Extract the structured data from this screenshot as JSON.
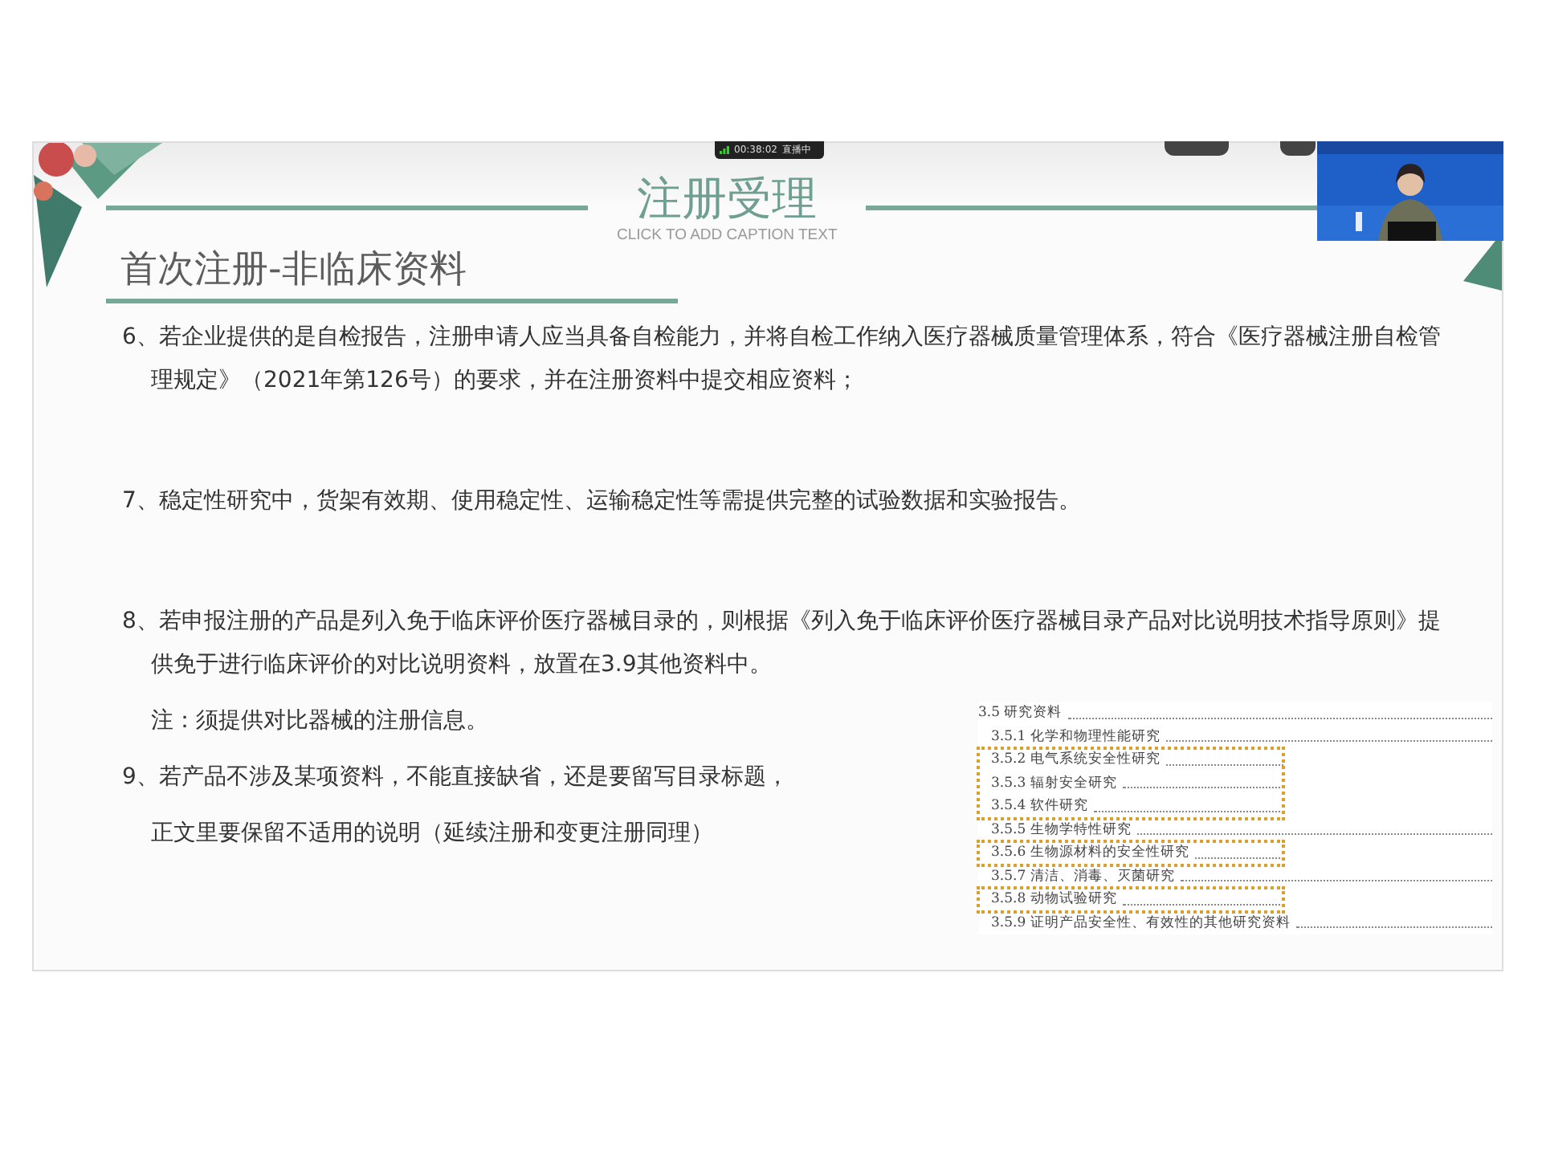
{
  "live_indicator": {
    "time": "00:38:02",
    "status": "直播中"
  },
  "slide": {
    "title": "注册受理",
    "caption": "CLICK TO ADD CAPTION TEXT",
    "subtitle": "首次注册-非临床资料",
    "paragraphs": [
      {
        "kind": "item",
        "text": "6、若企业提供的是自检报告，注册申请人应当具备自检能力，并将自检工作纳入医疗器械质量管理体系，符合《医疗器械注册自检管理规定》（2021年第126号）的要求，并在注册资料中提交相应资料；"
      },
      {
        "kind": "gap"
      },
      {
        "kind": "item",
        "text": "7、稳定性研究中，货架有效期、使用稳定性、运输稳定性等需提供完整的试验数据和实验报告。"
      },
      {
        "kind": "gap"
      },
      {
        "kind": "item",
        "text": "8、若申报注册的产品是列入免于临床评价医疗器械目录的，则根据《列入免于临床评价医疗器械目录产品对比说明技术指导原则》提供免于进行临床评价的对比说明资料，放置在3.9其他资料中。"
      },
      {
        "kind": "note",
        "text": "注：须提供对比器械的注册信息。"
      },
      {
        "kind": "item",
        "text": "9、若产品不涉及某项资料，不能直接缺省，还是要留写目录标题，"
      },
      {
        "kind": "note",
        "text": "正文里要保留不适用的说明（延续注册和变更注册同理）"
      }
    ],
    "toc": {
      "title": "3.5 研究资料",
      "groups": [
        {
          "highlighted": false,
          "entries": [
            "3.5.1 化学和物理性能研究"
          ]
        },
        {
          "highlighted": true,
          "entries": [
            "3.5.2 电气系统安全性研究",
            "3.5.3 辐射安全研究",
            "3.5.4 软件研究"
          ]
        },
        {
          "highlighted": false,
          "entries": [
            "3.5.5 生物学特性研究"
          ]
        },
        {
          "highlighted": true,
          "entries": [
            "3.5.6 生物源材料的安全性研究"
          ]
        },
        {
          "highlighted": false,
          "entries": [
            "3.5.7 清洁、消毒、灭菌研究"
          ]
        },
        {
          "highlighted": true,
          "entries": [
            "3.5.8 动物试验研究"
          ]
        },
        {
          "highlighted": false,
          "entries": [
            "3.5.9 证明产品安全性、有效性的其他研究资料"
          ]
        }
      ]
    }
  }
}
